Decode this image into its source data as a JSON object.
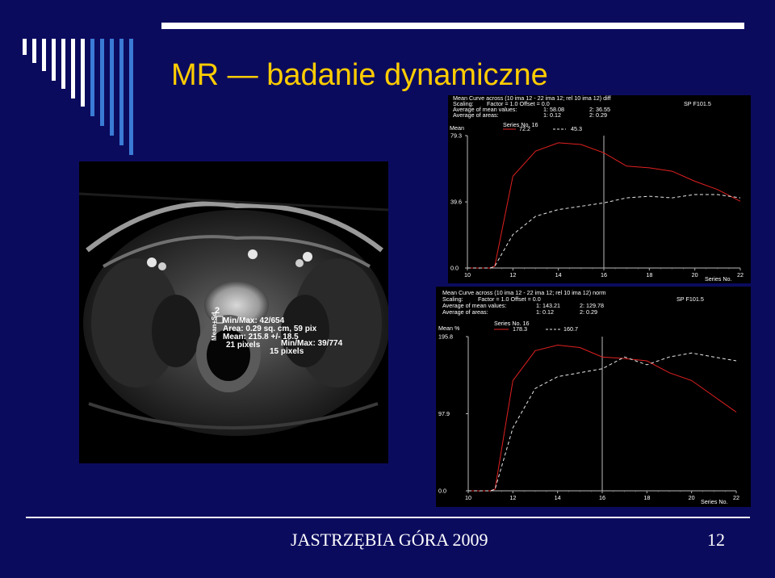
{
  "slide": {
    "title": "MR — badanie dynamiczne",
    "footer": "JASTRZĘBIA GÓRA 2009",
    "page_number": "12",
    "colors": {
      "background": "#0b0b5e",
      "title": "#ffcc00",
      "footer": "#ffffff"
    }
  },
  "mri_image": {
    "overlay": {
      "num1": "2",
      "vert": "Mean+Sd",
      "l1": "Min/Max: 42/654",
      "l2": "Area: 0.29 sq. cm, 59 pix",
      "l3": "Mean: 215.8 +/- 18.5",
      "l4": "21 pixels",
      "l5": "Min/Max: 39/774",
      "l6": "15 pixels"
    }
  },
  "chart_data": [
    {
      "type": "line",
      "header": {
        "line1": "Mean Curve across (10 ima 12 - 22 ima 12; rel 10 ima 12) diff",
        "scaling_label": "Scaling:",
        "scaling_value": "Factor = 1.0    Offset = 0.0",
        "avg_mean_label": "Average of mean values:",
        "avg_mean_1": "1:   58.08",
        "avg_mean_2": "2:   36.55",
        "avg_areas_label": "Average of areas:",
        "avg_areas_1": "1:   0.12",
        "avg_areas_2": "2:   0.29",
        "sp": "SP F101.5"
      },
      "ylabel": "Mean",
      "y_ticks": [
        "79.3",
        "39.6",
        "0.0"
      ],
      "x_ticks": [
        "10",
        "12",
        "14",
        "16",
        "18",
        "20",
        "22"
      ],
      "xlabel": "Series No.",
      "legend": {
        "title": "Series No. 16",
        "s1": "72.2",
        "s2": "45.3"
      },
      "ylim": [
        0,
        79.3
      ],
      "xlim": [
        10,
        22
      ],
      "marker_x": 16,
      "x": [
        10,
        10.5,
        11,
        11.2,
        12,
        13,
        14,
        15,
        16,
        17,
        18,
        19,
        20,
        21,
        22
      ],
      "series": [
        {
          "values": [
            0,
            0,
            0,
            1,
            55,
            70,
            75,
            74,
            69,
            61,
            60,
            58,
            52,
            47,
            40
          ],
          "color": "#e02020"
        },
        {
          "values": [
            0,
            0,
            0,
            1,
            20,
            31,
            35,
            37,
            39,
            42,
            43,
            42,
            44,
            44,
            42
          ],
          "color": "#e8e8e8"
        }
      ]
    },
    {
      "type": "line",
      "header": {
        "line1": "Mean Curve across (10 ima 12 - 22 ima 12; rel 10 ima 12) norm",
        "scaling_label": "Scaling:",
        "scaling_value": "Factor = 1.0    Offset = 0.0",
        "avg_mean_label": "Average of mean values:",
        "avg_mean_1": "1:   143.21",
        "avg_mean_2": "2:   129.78",
        "avg_areas_label": "Average of areas:",
        "avg_areas_1": "1:   0.12",
        "avg_areas_2": "2:   0.29",
        "sp": "SP F101.5"
      },
      "ylabel": "Mean %",
      "y_ticks": [
        "195.8",
        "97.9",
        "0.0"
      ],
      "x_ticks": [
        "10",
        "12",
        "14",
        "16",
        "18",
        "20",
        "22"
      ],
      "xlabel": "Series No.",
      "legend": {
        "title": "Series No. 16",
        "s1": "178.3",
        "s2": "160.7"
      },
      "ylim": [
        0,
        195.8
      ],
      "xlim": [
        10,
        22
      ],
      "marker_x": 16,
      "x": [
        10,
        10.5,
        11,
        11.2,
        12,
        13,
        14,
        15,
        16,
        17,
        18,
        19,
        20,
        21,
        22
      ],
      "series": [
        {
          "values": [
            0,
            0,
            0,
            2,
            140,
            178,
            185,
            182,
            170,
            168,
            165,
            150,
            140,
            120,
            100
          ],
          "color": "#e02020"
        },
        {
          "values": [
            0,
            0,
            0,
            2,
            80,
            130,
            145,
            150,
            155,
            170,
            160,
            170,
            175,
            170,
            165
          ],
          "color": "#e8e8e8"
        }
      ]
    }
  ]
}
